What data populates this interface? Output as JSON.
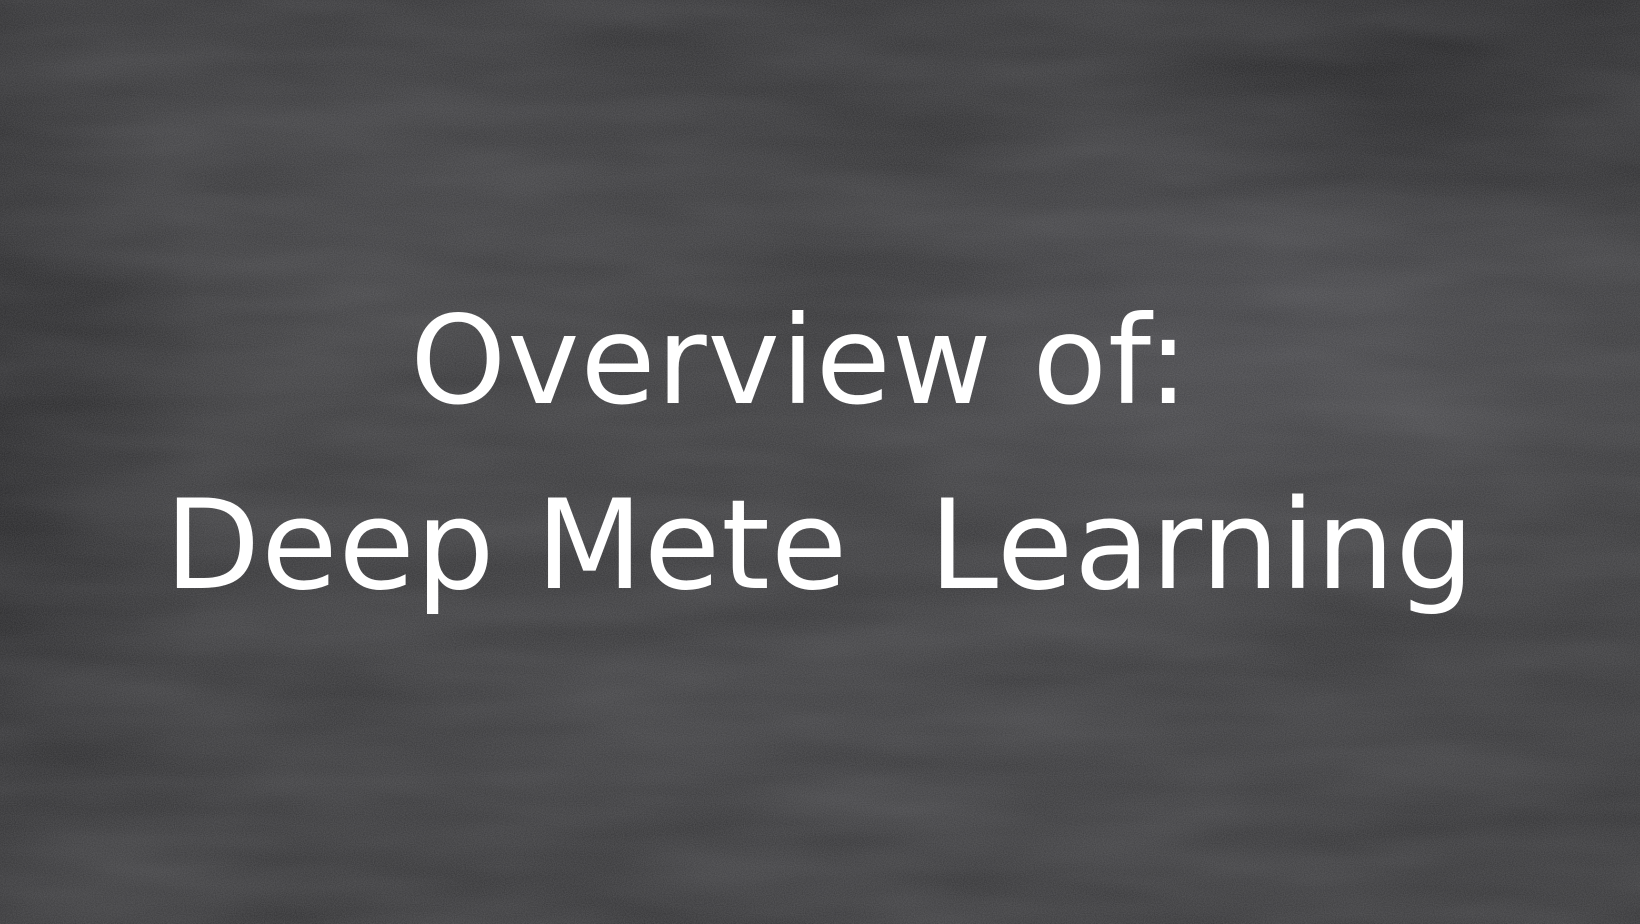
{
  "slide": {
    "title_line_1": "Overview of:",
    "title_line_2": "Deep Mete  Learning"
  },
  "colors": {
    "background": "#2f2f31",
    "text": "#ffffff"
  }
}
